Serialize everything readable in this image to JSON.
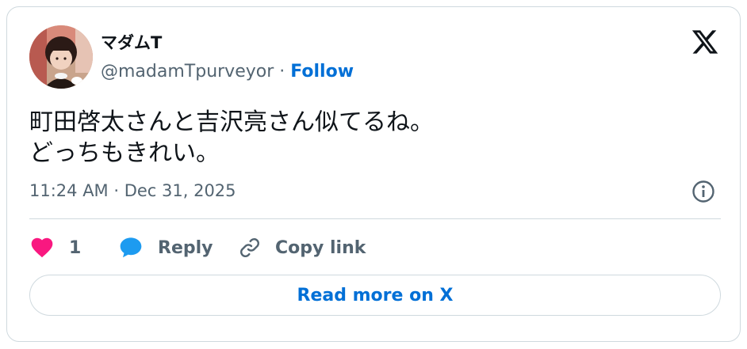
{
  "author": {
    "display_name": "マダムT",
    "handle": "@madamTpurveyor",
    "separator": "·",
    "follow_label": "Follow"
  },
  "brand": {
    "logo_icon": "x-logo-icon"
  },
  "tweet": {
    "lines": [
      "町田啓太さんと吉沢亮さん似てるね。",
      "どっちもきれい。"
    ],
    "timestamp": "11:24 AM · Dec 31, 2025"
  },
  "actions": {
    "like_count": "1",
    "reply_label": "Reply",
    "copy_link_label": "Copy link"
  },
  "footer": {
    "read_more_label": "Read more on X"
  },
  "colors": {
    "text_primary": "#0f1419",
    "text_secondary": "#536471",
    "link_blue": "#006fd6",
    "heart_pink": "#f91880",
    "reply_blue": "#1d9bf0",
    "border": "#cfd9de"
  }
}
